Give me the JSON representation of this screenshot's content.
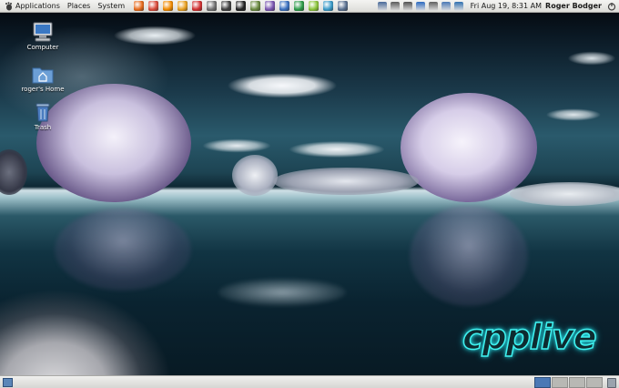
{
  "top_panel": {
    "menus": [
      {
        "label": "Applications",
        "icon": "gnome-foot-icon"
      },
      {
        "label": "Places"
      },
      {
        "label": "System"
      }
    ],
    "launchers": [
      {
        "name": "firefox-icon",
        "color": "#e66a1c"
      },
      {
        "name": "chrome-icon",
        "color": "#d94a3a"
      },
      {
        "name": "vlc-icon",
        "color": "#f08a00"
      },
      {
        "name": "cone-icon",
        "color": "#e8a020"
      },
      {
        "name": "x-tool-icon",
        "color": "#d03030"
      },
      {
        "name": "utility-icon",
        "color": "#707070"
      },
      {
        "name": "camera-icon",
        "color": "#404040"
      },
      {
        "name": "terminal-icon",
        "color": "#222222"
      },
      {
        "name": "system-monitor-icon",
        "color": "#6a8a40"
      },
      {
        "name": "document-icon",
        "color": "#7a55b0"
      },
      {
        "name": "media-player-icon",
        "color": "#3a70c0"
      },
      {
        "name": "spreadsheet-icon",
        "color": "#2c9a48"
      },
      {
        "name": "android-icon",
        "color": "#8bc43a"
      },
      {
        "name": "network-tool-icon",
        "color": "#3a9ac8"
      },
      {
        "name": "text-editor-icon",
        "color": "#5a7090"
      }
    ],
    "tray": [
      {
        "name": "display-icon",
        "color": "#4a6a9a"
      },
      {
        "name": "network-icon",
        "color": "#5a5a5a"
      },
      {
        "name": "volume-icon",
        "color": "#505050"
      },
      {
        "name": "bluetooth-icon",
        "color": "#2c6ac0"
      },
      {
        "name": "battery-icon",
        "color": "#606060"
      },
      {
        "name": "signal-icon",
        "color": "#4a78b5"
      },
      {
        "name": "update-icon",
        "color": "#3070b0"
      }
    ],
    "clock": "Fri Aug 19,  8:31 AM",
    "user": "Roger Bodger",
    "power_icon": "power-icon"
  },
  "desktop": {
    "icons": [
      {
        "label": "Computer",
        "icon": "computer-icon"
      },
      {
        "label": "roger's Home",
        "icon": "home-folder-icon"
      },
      {
        "label": "Trash",
        "icon": "trash-icon"
      }
    ],
    "logo_text": "cpplive"
  },
  "bottom_panel": {
    "show_desktop_icon": "show-desktop-icon",
    "workspaces": 4,
    "active_workspace": 1,
    "trash_icon": "trash-applet-icon"
  }
}
